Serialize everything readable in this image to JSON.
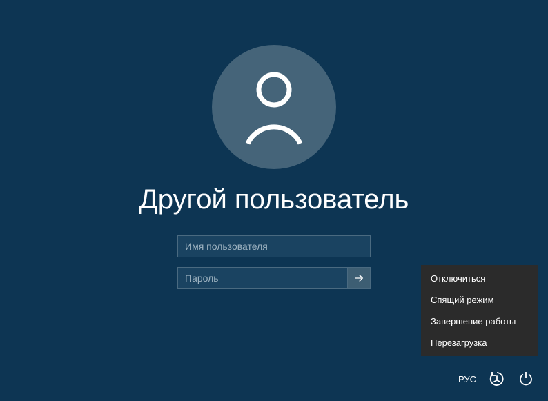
{
  "login": {
    "title": "Другой пользователь",
    "username_placeholder": "Имя пользователя",
    "password_placeholder": "Пароль"
  },
  "power_menu": {
    "items": [
      "Отключиться",
      "Спящий режим",
      "Завершение работы",
      "Перезагрузка"
    ]
  },
  "bottom_bar": {
    "language": "РУС"
  }
}
